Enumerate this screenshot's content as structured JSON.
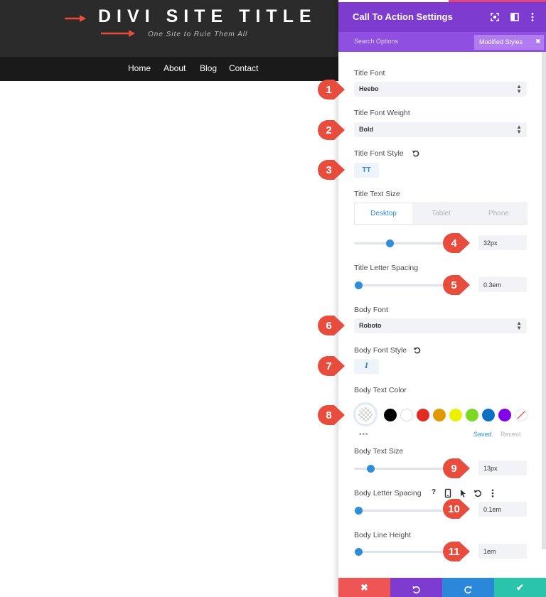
{
  "site": {
    "title": "DIVI SITE TITLE",
    "tagline": "One Site to Rule Them All",
    "nav": [
      "Home",
      "About",
      "Blog",
      "Contact"
    ]
  },
  "panel": {
    "title": "Call To Action Settings",
    "search_placeholder": "Search Options",
    "filter_badge": "Modified Styles",
    "fields": {
      "title_font": {
        "label": "Title Font",
        "value": "Heebo"
      },
      "title_font_weight": {
        "label": "Title Font Weight",
        "value": "Bold"
      },
      "title_font_style": {
        "label": "Title Font Style",
        "button": "TT"
      },
      "title_text_size": {
        "label": "Title Text Size",
        "tabs": [
          "Desktop",
          "Tablet",
          "Phone"
        ],
        "active_tab": "Desktop",
        "value": "32px"
      },
      "title_letter_spacing": {
        "label": "Title Letter Spacing",
        "value": "0.3em"
      },
      "body_font": {
        "label": "Body Font",
        "value": "Roboto"
      },
      "body_font_style": {
        "label": "Body Font Style",
        "button": "I"
      },
      "body_text_color": {
        "label": "Body Text Color",
        "swatches": [
          "#000000",
          "#ffffff",
          "#e02b20",
          "#e09900",
          "#edf000",
          "#7cda24",
          "#0c71c3",
          "#8300e9"
        ],
        "tabs": [
          "Saved",
          "Recent"
        ],
        "active_tab": "Saved"
      },
      "body_text_size": {
        "label": "Body Text Size",
        "value": "13px"
      },
      "body_letter_spacing": {
        "label": "Body Letter Spacing",
        "value": "0.1em"
      },
      "body_line_height": {
        "label": "Body Line Height",
        "value": "1em"
      }
    },
    "footer_colors": {
      "cancel": "#ef5555",
      "undo": "#7e3bd0",
      "redo": "#2b87da",
      "save": "#29c4a9"
    }
  },
  "callouts": [
    "1",
    "2",
    "3",
    "4",
    "5",
    "6",
    "7",
    "8",
    "9",
    "10",
    "11"
  ],
  "accent_colors": {
    "header_purple": "#7e3bd0",
    "active_blue": "#2e8ed8",
    "callout_red": "#e74c3c"
  }
}
